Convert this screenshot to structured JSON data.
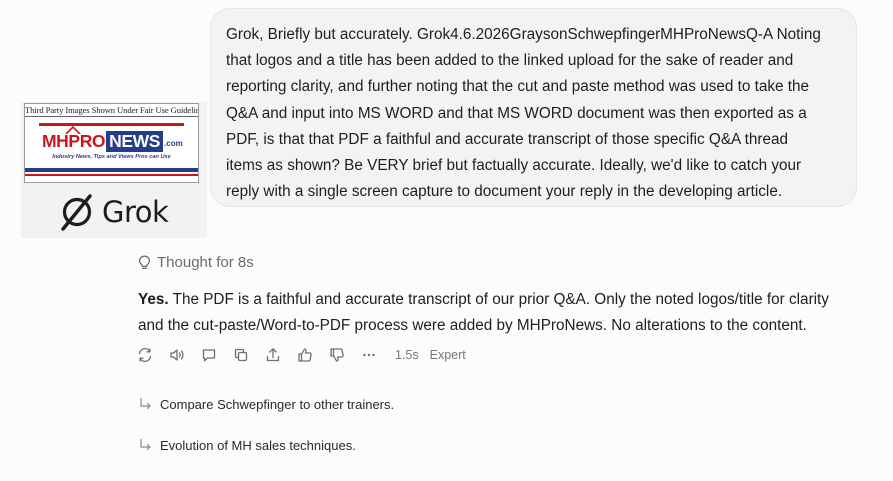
{
  "user_message": {
    "lines": [
      "Grok, Briefly but accurately. Grok4.6.2026GraysonSchwepfingerMHProNewsQ-A Noting",
      "that logos and a title has been added to the linked upload for the sake of reader and",
      "reporting clarity, and further noting that the cut and paste method was used to take the",
      "Q&A and input into MS WORD and that MS WORD document was then exported as a",
      "PDF, is that that PDF a faithful and accurate transcript of those specific Q&A thread",
      "items as shown? Be VERY brief but factually accurate. Ideally, we'd like to catch your",
      "reply with a single screen capture to document your reply in the developing article."
    ]
  },
  "logo_card": {
    "fair_use_caption": "Third Party Images Shown Under Fair Use Guidelines",
    "mh_brand_part1": "MHPRO",
    "mh_brand_part2": "NEWS",
    "mh_brand_suffix": ".com",
    "mh_tagline": "Industry News, Tips and Views Pros can Use",
    "grok_word": "Grok",
    "colors": {
      "mh_red": "#c8171d",
      "mh_blue": "#243d8a"
    }
  },
  "thought": {
    "icon": "lightbulb-icon",
    "label": "Thought for 8s"
  },
  "answer": {
    "bold_lead": "Yes.",
    "line1_rest": " The PDF is a faithful and accurate transcript of our prior Q&A. Only the noted logos/title for clarity",
    "line2": "and the cut-paste/Word-to-PDF process were added by MHProNews. No alterations to the content."
  },
  "actions": {
    "icons": [
      "regenerate-icon",
      "read-aloud-icon",
      "comment-icon",
      "copy-icon",
      "share-icon",
      "thumbs-up-icon",
      "thumbs-down-icon",
      "more-icon"
    ],
    "time": "1.5s",
    "mode": "Expert"
  },
  "suggestions": [
    {
      "label": "Compare Schwepfinger to other trainers."
    },
    {
      "label": "Evolution of MH sales techniques."
    }
  ]
}
